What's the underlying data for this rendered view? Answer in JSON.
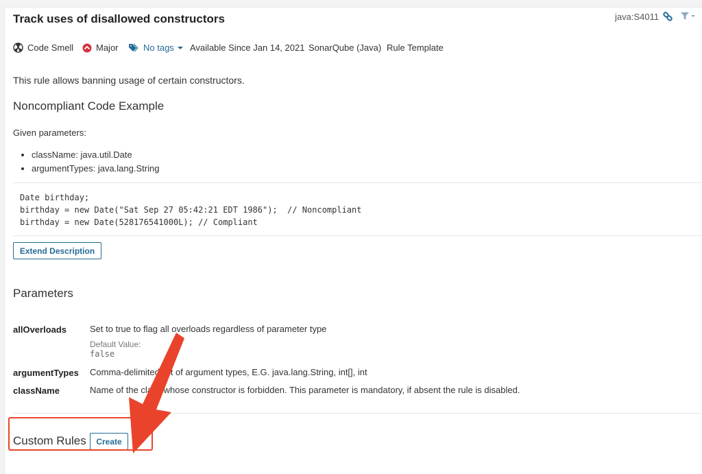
{
  "rule": {
    "title": "Track uses of disallowed constructors",
    "key": "java:S4011"
  },
  "meta": {
    "type_label": "Code Smell",
    "type_icon": "code-smell-icon",
    "severity_label": "Major",
    "severity_icon": "major-severity-icon",
    "tags_label": "No tags",
    "available_since": "Available Since Jan 14, 2021",
    "repository": "SonarQube (Java)",
    "template": "Rule Template"
  },
  "description": {
    "intro": "This rule allows banning usage of certain constructors.",
    "heading": "Noncompliant Code Example",
    "given": "Given parameters:",
    "bullets": [
      "className: java.util.Date",
      "argumentTypes: java.lang.String"
    ],
    "code": [
      "Date birthday;",
      "birthday = new Date(\"Sat Sep 27 05:42:21 EDT 1986\");  // Noncompliant",
      "birthday = new Date(528176541000L); // Compliant"
    ],
    "extend_button": "Extend Description"
  },
  "parameters": {
    "heading": "Parameters",
    "items": [
      {
        "name": "allOverloads",
        "description": "Set to true to flag all overloads regardless of parameter type",
        "default_label": "Default Value:",
        "default_value": "false"
      },
      {
        "name": "argumentTypes",
        "description": "Comma-delimited list of argument types, E.G. java.lang.String, int[], int"
      },
      {
        "name": "className",
        "description": "Name of the class whose constructor is forbidden. This parameter is mandatory, if absent the rule is disabled."
      }
    ]
  },
  "custom_rules": {
    "heading": "Custom Rules",
    "create_button": "Create"
  },
  "colors": {
    "link": "#236a97",
    "severity": "#d4333f",
    "annotation": "#e9442b"
  }
}
